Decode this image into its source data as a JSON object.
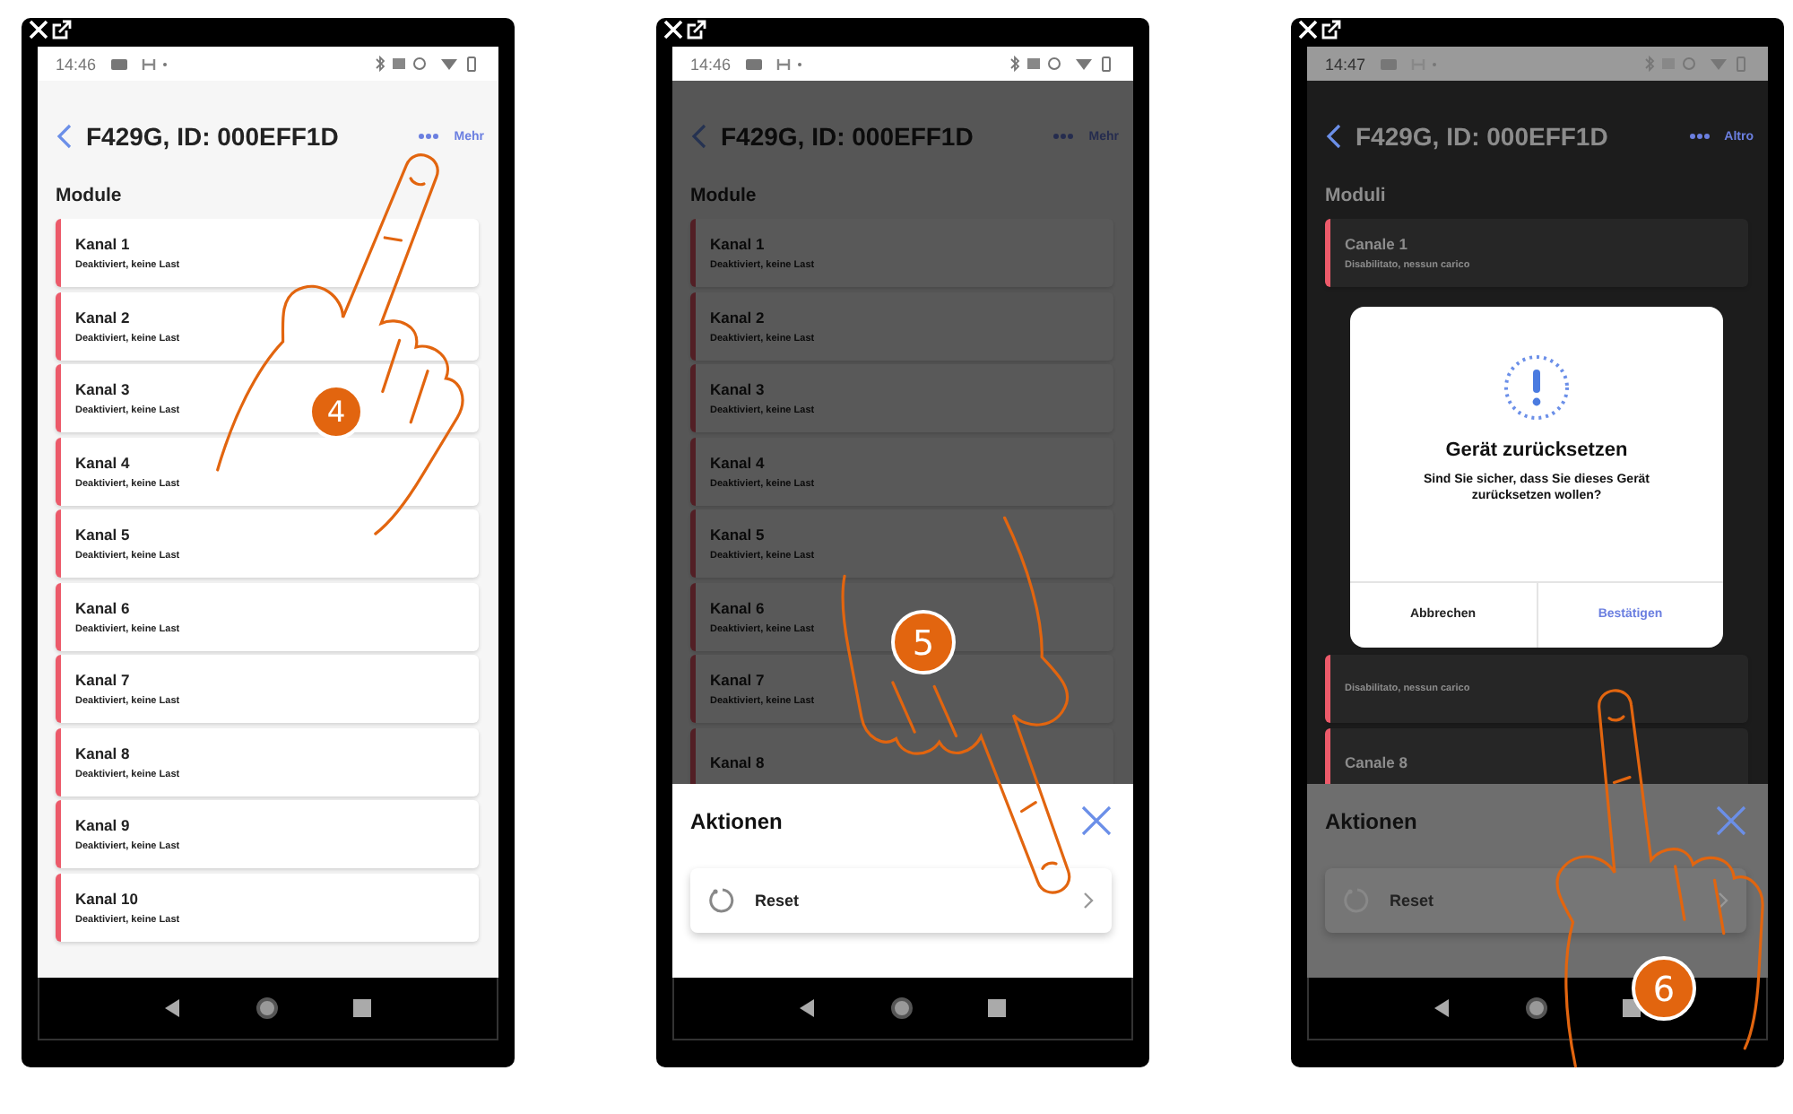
{
  "phones": [
    {
      "step": "4",
      "status_time": "14:46",
      "title": "F429G, ID: 000EFF1D",
      "more_label": "Mehr",
      "section_title": "Module",
      "rows": [
        {
          "title": "Kanal 1",
          "subtitle": "Deaktiviert, keine Last"
        },
        {
          "title": "Kanal 2",
          "subtitle": "Deaktiviert, keine Last"
        },
        {
          "title": "Kanal 3",
          "subtitle": "Deaktiviert, keine Last"
        },
        {
          "title": "Kanal 4",
          "subtitle": "Deaktiviert, keine Last"
        },
        {
          "title": "Kanal 5",
          "subtitle": "Deaktiviert, keine Last"
        },
        {
          "title": "Kanal 6",
          "subtitle": "Deaktiviert, keine Last"
        },
        {
          "title": "Kanal 7",
          "subtitle": "Deaktiviert, keine Last"
        },
        {
          "title": "Kanal 8",
          "subtitle": "Deaktiviert, keine Last"
        },
        {
          "title": "Kanal 9",
          "subtitle": "Deaktiviert, keine Last"
        },
        {
          "title": "Kanal 10",
          "subtitle": "Deaktiviert, keine Last"
        }
      ]
    },
    {
      "step": "5",
      "status_time": "14:46",
      "title": "F429G, ID: 000EFF1D",
      "more_label": "Mehr",
      "section_title": "Module",
      "rows": [
        {
          "title": "Kanal 1",
          "subtitle": "Deaktiviert, keine Last"
        },
        {
          "title": "Kanal 2",
          "subtitle": "Deaktiviert, keine Last"
        },
        {
          "title": "Kanal 3",
          "subtitle": "Deaktiviert, keine Last"
        },
        {
          "title": "Kanal 4",
          "subtitle": "Deaktiviert, keine Last"
        },
        {
          "title": "Kanal 5",
          "subtitle": "Deaktiviert, keine Last"
        },
        {
          "title": "Kanal 6",
          "subtitle": "Deaktiviert, keine Last"
        },
        {
          "title": "Kanal 7",
          "subtitle": "Deaktiviert, keine Last"
        },
        {
          "title": "Kanal 8"
        }
      ],
      "sheet": {
        "title": "Aktionen",
        "items": [
          {
            "label": "Reset"
          }
        ]
      }
    },
    {
      "step": "6",
      "status_time": "14:47",
      "title": "F429G, ID: 000EFF1D",
      "more_label": "Altro",
      "section_title": "Moduli",
      "rows": [
        {
          "title": "Canale 1",
          "subtitle": "Disabilitato, nessun carico"
        }
      ],
      "dialog": {
        "title": "Gerät zurücksetzen",
        "message": "Sind Sie sicher, dass Sie dieses Gerät zurücksetzen wollen?",
        "buttons": [
          {
            "label": "Abbrechen",
            "primary": false
          },
          {
            "label": "Bestätigen",
            "primary": true
          }
        ]
      },
      "rows_below": [
        {
          "subtitle": "Disabilitato, nessun carico"
        },
        {
          "title": "Canale 8"
        }
      ],
      "sheet": {
        "title": "Aktionen",
        "items": [
          {
            "label": "Reset"
          }
        ]
      }
    }
  ]
}
